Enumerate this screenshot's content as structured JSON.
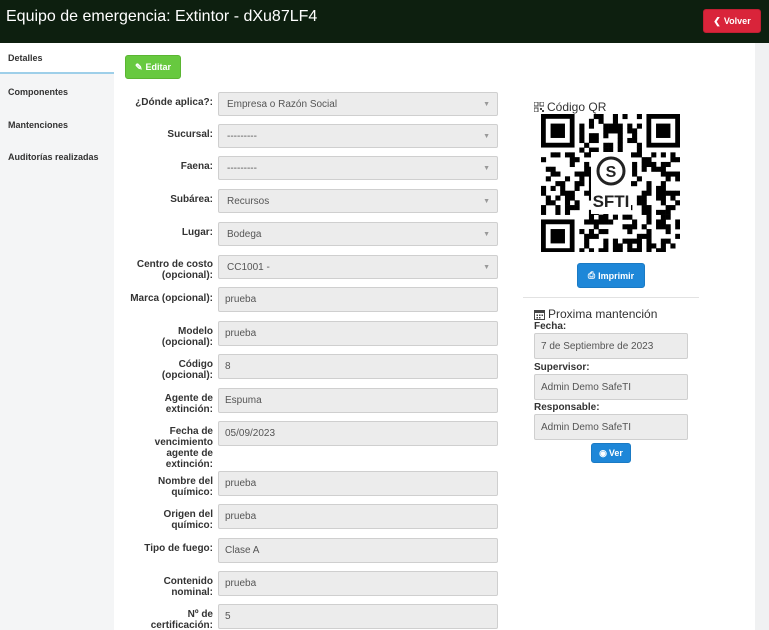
{
  "header": {
    "title": "Equipo de emergencia: Extintor - dXu87LF4",
    "back_label": "Volver"
  },
  "sidebar": {
    "items": [
      {
        "label": "Detalles"
      },
      {
        "label": "Componentes"
      },
      {
        "label": "Mantenciones"
      },
      {
        "label": "Auditorías realizadas"
      }
    ]
  },
  "toolbar": {
    "edit_label": "Editar"
  },
  "form": {
    "donde_aplica": {
      "label": "¿Dónde aplica?:",
      "value": "Empresa o Razón Social"
    },
    "sucursal": {
      "label": "Sucursal:",
      "value": "---------"
    },
    "faena": {
      "label": "Faena:",
      "value": "---------"
    },
    "subarea": {
      "label": "Subárea:",
      "value": "Recursos"
    },
    "lugar": {
      "label": "Lugar:",
      "value": "Bodega"
    },
    "centro_costo": {
      "label_line1": "Centro de costo",
      "label_line2": "(opcional):",
      "value": "CC1001 -"
    },
    "marca": {
      "label": "Marca (opcional):",
      "value": "prueba"
    },
    "modelo": {
      "label_line1": "Modelo",
      "label_line2": "(opcional):",
      "value": "prueba"
    },
    "codigo": {
      "label_line1": "Código",
      "label_line2": "(opcional):",
      "value": "8"
    },
    "agente": {
      "label_line1": "Agente de",
      "label_line2": "extinción:",
      "value": "Espuma"
    },
    "fecha_venc": {
      "label_line1": "Fecha de",
      "label_line2": "vencimiento",
      "label_line3": "agente de",
      "label_line4": "extinción:",
      "value": "05/09/2023"
    },
    "nombre_quimico": {
      "label_line1": "Nombre del",
      "label_line2": "químico:",
      "value": "prueba"
    },
    "origen_quimico": {
      "label_line1": "Origen del",
      "label_line2": "químico:",
      "value": "prueba"
    },
    "tipo_fuego": {
      "label": "Tipo de fuego:",
      "value": "Clase A"
    },
    "contenido": {
      "label_line1": "Contenido",
      "label_line2": "nominal:",
      "value": "prueba"
    },
    "certificacion": {
      "label_line1": "Nº de",
      "label_line2": "certificación:",
      "value": "5"
    }
  },
  "qr": {
    "title": "Código QR",
    "logo_text": "SFTI",
    "print_label": "Imprimir"
  },
  "maintenance": {
    "title": "Proxima mantención",
    "fecha_label": "Fecha:",
    "fecha_value": "7 de Septiembre de 2023",
    "supervisor_label": "Supervisor:",
    "supervisor_value": "Admin Demo SafeTI",
    "responsable_label": "Responsable:",
    "responsable_value": "Admin Demo SafeTI",
    "view_label": "Ver"
  }
}
